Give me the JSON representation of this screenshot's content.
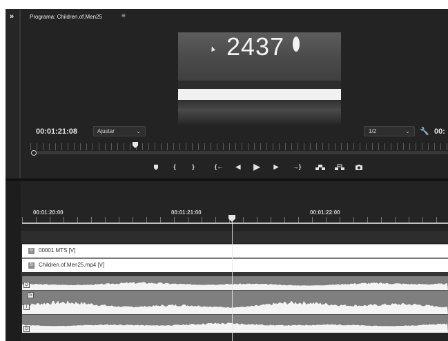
{
  "monitor": {
    "collapse_label": "»",
    "title": "Programa: Children.of.Men25",
    "menu_icon": "≡",
    "video_overlay_text": "2437",
    "timecode": "00:01:21:08",
    "fit_label": "Ajustar",
    "resolution_label": "1/2",
    "timecode_right": "00:",
    "transport": {
      "mark_in": "{",
      "mark_out": "}",
      "go_to_in": "{←",
      "step_back": "◀",
      "play": "▶",
      "step_forward": "▶",
      "go_to_out": "→}"
    }
  },
  "timeline": {
    "ruler_times": [
      "00:01:20:00",
      "00:01:21:00",
      "00:01:22:00"
    ],
    "clips": [
      {
        "fx": "fx",
        "label": "00001.MTS [V]"
      },
      {
        "fx": "fx",
        "label": "Children.of.Men25.mp4 [V]"
      }
    ],
    "audio_badges": [
      "D",
      "fx",
      "I",
      "D"
    ]
  },
  "colors": {
    "panel_bg": "#232323",
    "clip_bg": "#ffffff",
    "audio_bg": "#7f7f7f",
    "waveform": "#f4f4f4"
  }
}
